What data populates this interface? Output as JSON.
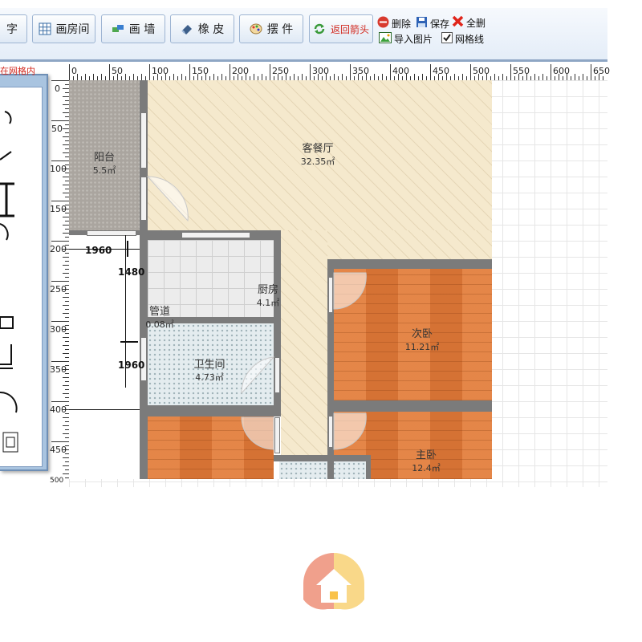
{
  "toolbar": {
    "buttons": [
      {
        "label": "字",
        "icon": "text-icon"
      },
      {
        "label": "画房间",
        "icon": "grid-icon"
      },
      {
        "label": "画 墙",
        "icon": "wall-tool-icon"
      },
      {
        "label": "橡 皮",
        "icon": "eraser-icon"
      },
      {
        "label": "摆 件",
        "icon": "palette-icon"
      },
      {
        "label": "返回箭头",
        "icon": "refresh-arrow-icon"
      }
    ],
    "delete_label": "删除",
    "save_label": "保存",
    "delete_all_label": "全删",
    "import_image_label": "导入图片",
    "gridlines_label": "网格线",
    "gridlines_checked": true
  },
  "panel_tab_label": "在网格内",
  "ruler": {
    "h_ticks": [
      "0",
      "50",
      "100",
      "150",
      "200",
      "250",
      "300",
      "350",
      "400",
      "450",
      "500",
      "550",
      "600",
      "650"
    ],
    "v_ticks": [
      "0",
      "50",
      "100",
      "150",
      "200",
      "250",
      "300",
      "350",
      "400",
      "450",
      "500"
    ]
  },
  "rooms": [
    {
      "id": "balcony",
      "name": "阳台",
      "area": "5.5㎡"
    },
    {
      "id": "living",
      "name": "客餐厅",
      "area": "32.35㎡"
    },
    {
      "id": "kitchen",
      "name": "厨房",
      "area": "4.1㎡"
    },
    {
      "id": "duct",
      "name": "管道",
      "area": "0.08㎡"
    },
    {
      "id": "bathroom",
      "name": "卫生间",
      "area": "4.73㎡"
    },
    {
      "id": "second-bedroom",
      "name": "次卧",
      "area": "11.21㎡"
    },
    {
      "id": "master-bedroom",
      "name": "主卧",
      "area": "12.4㎡"
    }
  ],
  "dimensions": [
    "1960",
    "1480",
    "1960"
  ],
  "colors": {
    "toolbar_bg": "#e4edf8",
    "panel_blue": "#a9c4e0",
    "wall": "#7b7b7b",
    "wood": "#e07b3a",
    "living_floor": "#f5e9cd",
    "return_label": "#d2281e",
    "logo_orange": "#f0a08c",
    "logo_yellow": "#f9d889"
  },
  "logo_icon": "house-logo-icon"
}
